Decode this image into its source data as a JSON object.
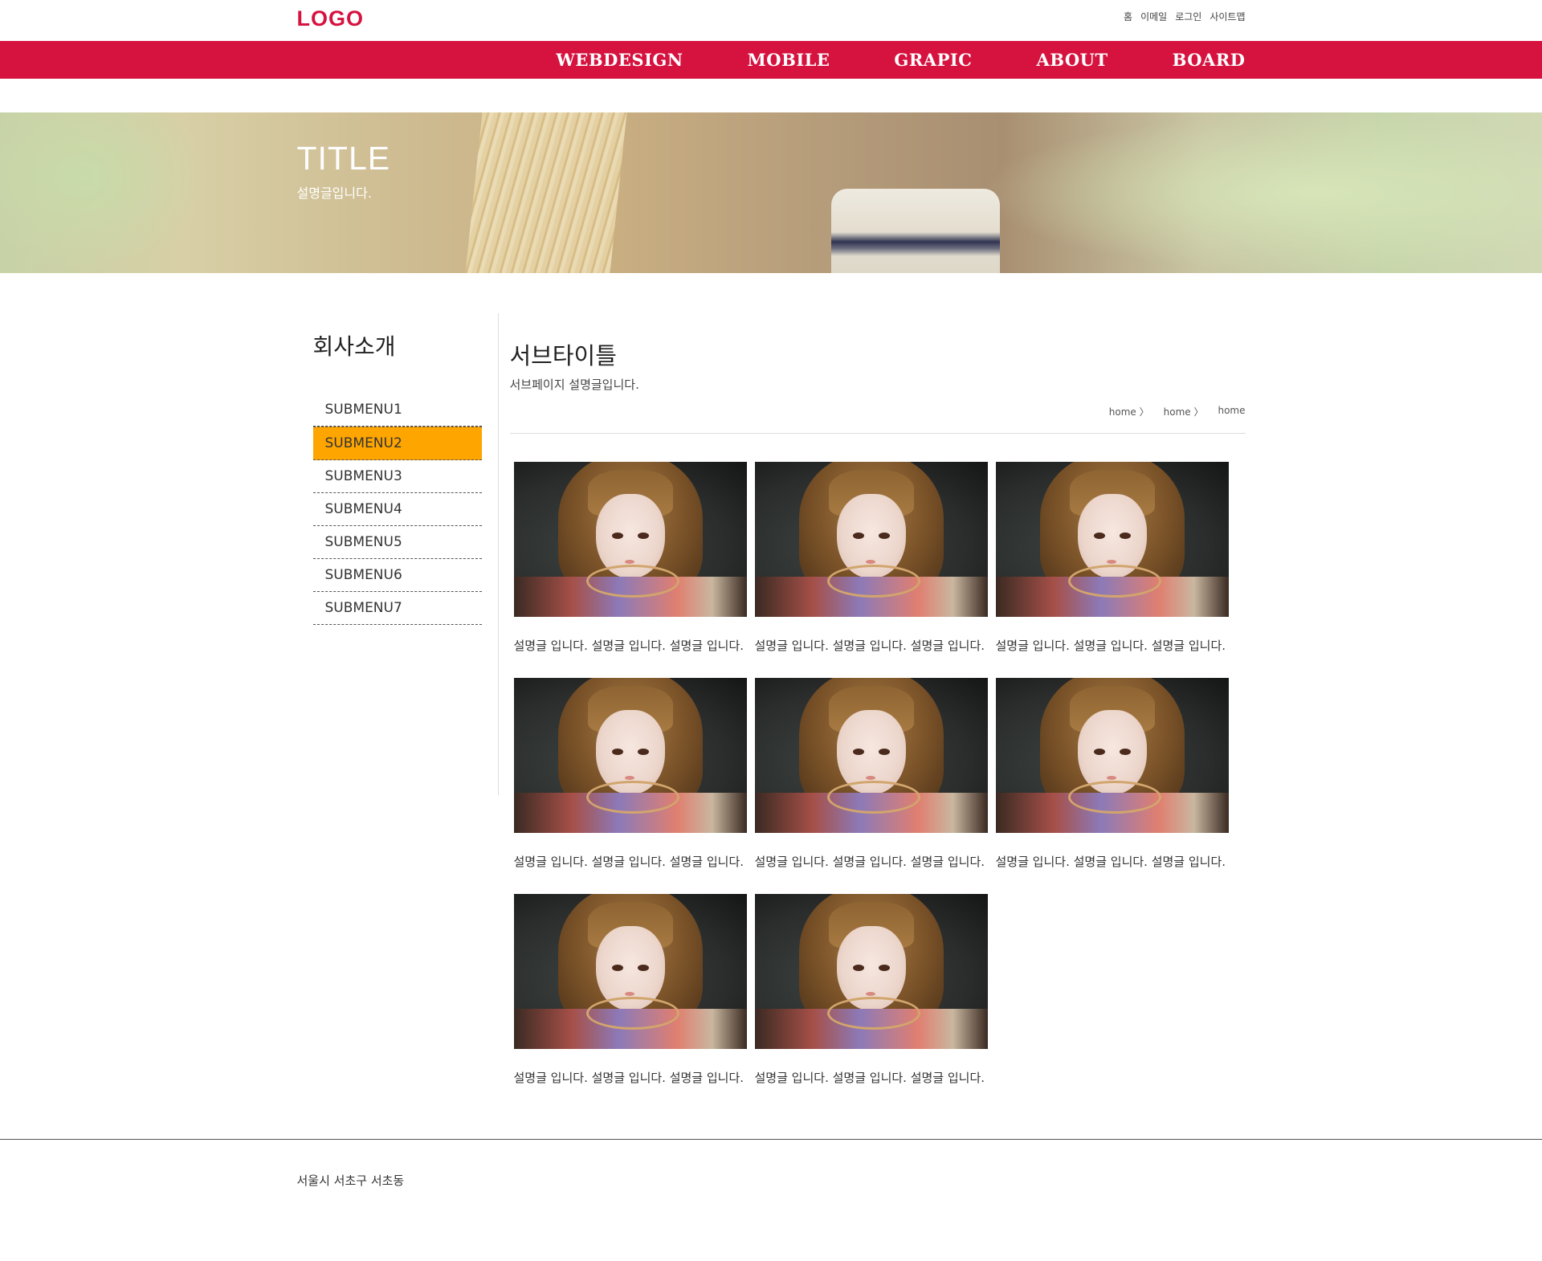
{
  "colors": {
    "brand": "#d6123f",
    "active_submenu": "#ffa500"
  },
  "header": {
    "logo": "LOGO",
    "util_links": [
      "홈",
      "이메일",
      "로그인",
      "사이트맵"
    ]
  },
  "gnb": {
    "items": [
      "WEBDESIGN",
      "MOBILE",
      "GRAPIC",
      "ABOUT",
      "BOARD"
    ]
  },
  "visual": {
    "title": "TITLE",
    "description": "설명글입니다."
  },
  "lnb": {
    "title": "회사소개",
    "items": [
      "SUBMENU1",
      "SUBMENU2",
      "SUBMENU3",
      "SUBMENU4",
      "SUBMENU5",
      "SUBMENU6",
      "SUBMENU7"
    ],
    "active_item": "SUBMENU2"
  },
  "main": {
    "sub_title": "서브타이틀",
    "sub_description": "서브페이지 설명글입니다.",
    "breadcrumb": [
      "home 〉",
      "home 〉",
      "home"
    ]
  },
  "gallery": {
    "items": [
      {
        "caption": "설명글 입니다. 설명글 입니다. 설명글 입니다."
      },
      {
        "caption": "설명글 입니다. 설명글 입니다. 설명글 입니다."
      },
      {
        "caption": "설명글 입니다. 설명글 입니다. 설명글 입니다."
      },
      {
        "caption": "설명글 입니다. 설명글 입니다. 설명글 입니다."
      },
      {
        "caption": "설명글 입니다. 설명글 입니다. 설명글 입니다."
      },
      {
        "caption": "설명글 입니다. 설명글 입니다. 설명글 입니다."
      },
      {
        "caption": "설명글 입니다. 설명글 입니다. 설명글 입니다."
      },
      {
        "caption": "설명글 입니다. 설명글 입니다. 설명글 입니다."
      }
    ]
  },
  "footer": {
    "address": "서울시 서초구 서초동"
  }
}
